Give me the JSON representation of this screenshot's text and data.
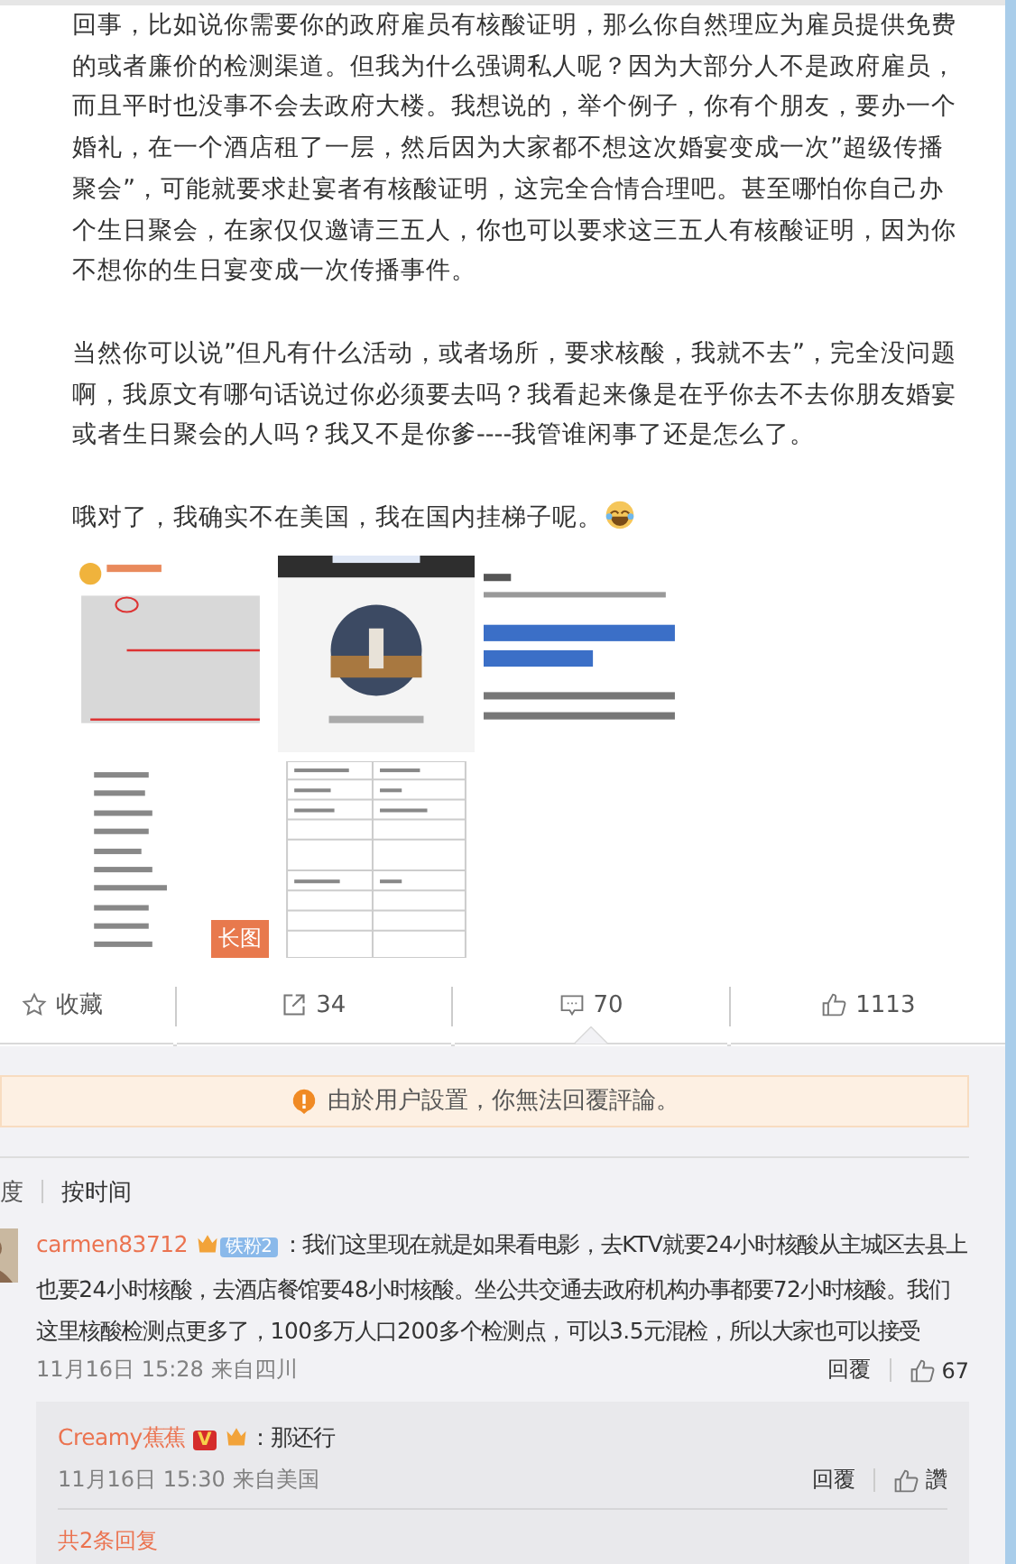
{
  "post": {
    "paragraphs": [
      "回事，比如说你需要你的政府雇员有核酸证明，那么你自然理应为雇员提供免费的或者廉价的检测渠道。但我为什么强调私人呢？因为大部分人不是政府雇员，而且平时也没事不会去政府大楼。我想说的，举个例子，你有个朋友，要办一个婚礼，在一个酒店租了一层，然后因为大家都不想这次婚宴变成一次”超级传播聚会”，可能就要求赴宴者有核酸证明，这完全合情合理吧。甚至哪怕你自己办个生日聚会，在家仅仅邀请三五人，你也可以要求这三五人有核酸证明，因为你不想你的生日宴变成一次传播事件。",
      "当然你可以说”但凡有什么活动，或者场所，要求核酸，我就不去”，完全没问题啊，我原文有哪句话说过你必须要去吗？我看起来像是在乎你去不去你朋友婚宴或者生日聚会的人吗？我又不是你爹----我管谁闲事了还是怎么了。",
      "哦对了，我确实不在美国，我在国内挂梯子呢。"
    ],
    "images": [
      {
        "kind": "picture"
      },
      {
        "kind": "picture"
      },
      {
        "kind": "picture"
      },
      {
        "kind": "picture",
        "badge": "长图"
      },
      {
        "kind": "picture"
      }
    ]
  },
  "actions": [
    {
      "kind": "favorite",
      "label": "收藏",
      "selected": false
    },
    {
      "kind": "share",
      "label": "34",
      "selected": false
    },
    {
      "kind": "comment",
      "label": "70",
      "selected": true
    },
    {
      "kind": "like",
      "label": "1113",
      "selected": false
    }
  ],
  "notice": "由於用户設置，你無法回覆評論。",
  "sort_tabs": [
    {
      "label": "度",
      "selected": false
    },
    {
      "label": "按时间",
      "selected": true
    }
  ],
  "comments": [
    {
      "user": "carmen83712",
      "fan_badge": "铁粉2",
      "text": "：我们这里现在就是如果看电影，去KTV就要24小时核酸从主城区去县上也要24小时核酸，去酒店餐馆要48小时核酸。坐公共交通去政府机构办事都要72小时核酸。我们这里核酸检测点更多了，100多万人口200多个检测点，可以3.5元混检，所以大家也可以接受",
      "meta": "11月16日 15:28 来自四川",
      "reply_label": "回覆",
      "likes": "67",
      "replies": [
        {
          "user": "Creamy蕉蕉",
          "verified": "V",
          "text": "：那还行",
          "meta": "11月16日 15:30 来自美国",
          "reply_label": "回覆",
          "likes": "讚"
        }
      ],
      "more": "共2条回复"
    }
  ]
}
